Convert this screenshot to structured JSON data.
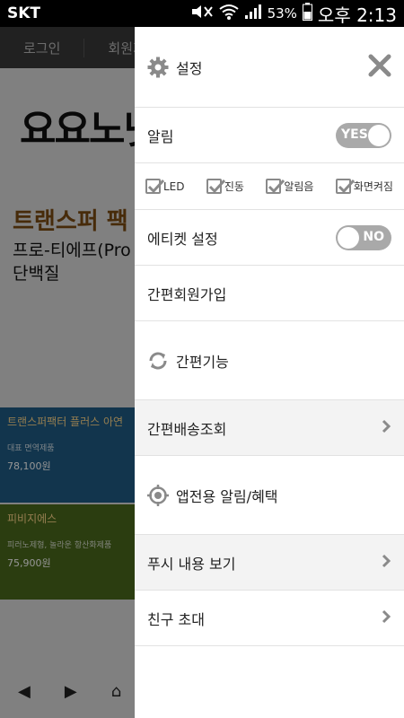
{
  "status_bar": {
    "carrier": "SKT",
    "battery": "53%",
    "time": "오후 2:13"
  },
  "background_page": {
    "nav": [
      "로그인",
      "회원가"
    ],
    "logo": "요요노넷",
    "headline": "트랜스퍼 팩",
    "subheadline": "프로-티에프(Pro",
    "subheadline2": "단백질",
    "products": [
      {
        "name": "트랜스퍼팩터 플러스 아연",
        "desc": "대표 면역제품",
        "price": "78,100원"
      },
      {
        "name": "피비지에스",
        "desc": "피러노제형, 놀라운 항산화제품",
        "price": "75,900원"
      }
    ]
  },
  "drawer": {
    "header": {
      "title": "설정",
      "icon": "gear-icon",
      "close_icon": "close-icon"
    },
    "notification": {
      "label": "알림",
      "toggle": "YES",
      "enabled": true
    },
    "notification_options": [
      {
        "label": "LED",
        "checked": true
      },
      {
        "label": "진동",
        "checked": true
      },
      {
        "label": "알림음",
        "checked": true
      },
      {
        "label": "화면켜짐",
        "checked": true
      }
    ],
    "etiquette": {
      "label": "에티켓 설정",
      "toggle": "NO",
      "enabled": false
    },
    "menu": {
      "simple_signup": "간편회원가입",
      "simple_functions": "간편기능",
      "delivery_lookup": "간편배송조회",
      "app_alerts": "앱전용 알림/혜택",
      "push_view": "푸시 내용 보기",
      "invite_friends": "친구 초대"
    }
  },
  "colors": {
    "toggle_bg": "#a9a9a9",
    "section_gray": "#f3f3f3",
    "icon_gray": "#8a8a8a"
  }
}
